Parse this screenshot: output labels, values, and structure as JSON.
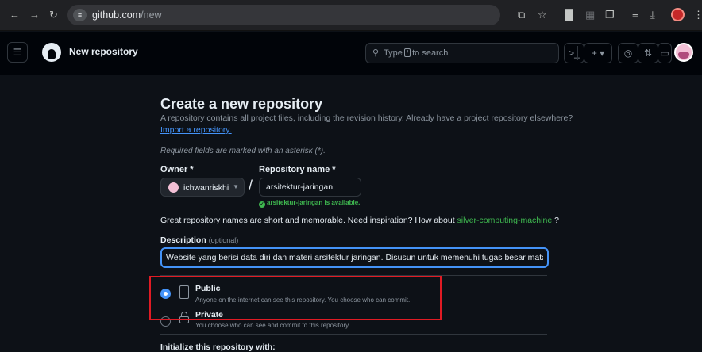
{
  "browser": {
    "url_host": "github.com",
    "url_path": "/new",
    "icons": [
      "back-arrow",
      "forward-arrow",
      "reload",
      "site-info",
      "open-in-app",
      "bookmark-star",
      "reading-list",
      "extension",
      "puzzle",
      "tab-search",
      "download",
      "profile",
      "kebab-menu"
    ]
  },
  "header": {
    "context_title": "New repository",
    "search_text_before": "Type",
    "search_key": "/",
    "search_text_after": "to search",
    "icons": [
      "menu",
      "github-logo",
      "search",
      "command-palette",
      "create-new",
      "issues",
      "pull-requests",
      "inbox",
      "avatar"
    ]
  },
  "form": {
    "heading": "Create a new repository",
    "subtext": "A repository contains all project files, including the revision history. Already have a project repository elsewhere?",
    "import_link": "Import a repository.",
    "required_note": "Required fields are marked with an asterisk (*).",
    "owner_label": "Owner *",
    "owner_name": "ichwanriskhi",
    "separator": "/",
    "repo_label": "Repository name *",
    "repo_name": "arsitektur-jaringan",
    "availability": "arsitektur-jaringan is available.",
    "name_hint": "Great repository names are short and memorable. Need inspiration? How about",
    "suggestion": "silver-computing-machine",
    "name_hint_end": "?",
    "description_label": "Description",
    "description_optional": "(optional)",
    "description_value": "Website yang berisi data diri dan materi arsitektur jaringan. Disusun untuk memenuhi tugas besar mata kuliah",
    "visibility": {
      "selected": "Public",
      "options": [
        {
          "title": "Public",
          "desc": "Anyone on the internet can see this repository. You choose who can commit."
        },
        {
          "title": "Private",
          "desc": "You choose who can see and commit to this repository."
        }
      ]
    },
    "init_label": "Initialize this repository with:"
  },
  "colors": {
    "page_bg": "#0d1117",
    "header_bg": "#010409",
    "accent_blue": "#4493f8",
    "success_green": "#3fb950",
    "highlight_red": "#e01b24"
  }
}
